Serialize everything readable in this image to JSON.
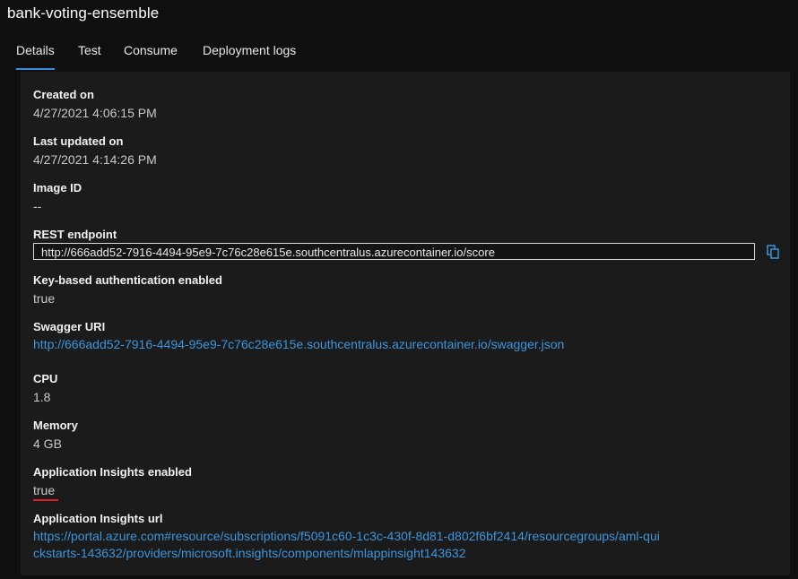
{
  "header": {
    "title": "bank-voting-ensemble"
  },
  "tabs": [
    {
      "label": "Details"
    },
    {
      "label": "Test"
    },
    {
      "label": "Consume"
    },
    {
      "label": "Deployment logs"
    }
  ],
  "details": {
    "created_on": {
      "label": "Created on",
      "value": "4/27/2021 4:06:15 PM"
    },
    "last_updated": {
      "label": "Last updated on",
      "value": "4/27/2021 4:14:26 PM"
    },
    "image_id": {
      "label": "Image ID",
      "value": "--"
    },
    "rest_endpoint": {
      "label": "REST endpoint",
      "value": "http://666add52-7916-4494-95e9-7c76c28e615e.southcentralus.azurecontainer.io/score"
    },
    "key_auth": {
      "label": "Key-based authentication enabled",
      "value": "true"
    },
    "swagger": {
      "label": "Swagger URI",
      "value": "http://666add52-7916-4494-95e9-7c76c28e615e.southcentralus.azurecontainer.io/swagger.json"
    },
    "cpu": {
      "label": "CPU",
      "value": "1.8"
    },
    "memory": {
      "label": "Memory",
      "value": "4 GB"
    },
    "app_insights": {
      "label": "Application Insights enabled",
      "value": "true"
    },
    "app_insights_url": {
      "label": "Application Insights url",
      "line1": "https://portal.azure.com#resource/subscriptions/f5091c60-1c3c-430f-8d81-d802f6bf2414/resourcegroups/aml-qui",
      "line2": "ckstarts-143632/providers/microsoft.insights/components/mlappinsight143632"
    }
  },
  "icons": {
    "copy": "copy-icon"
  },
  "colors": {
    "accent": "#2f8ee0",
    "link": "#3a96dd",
    "highlight": "#e02020"
  }
}
